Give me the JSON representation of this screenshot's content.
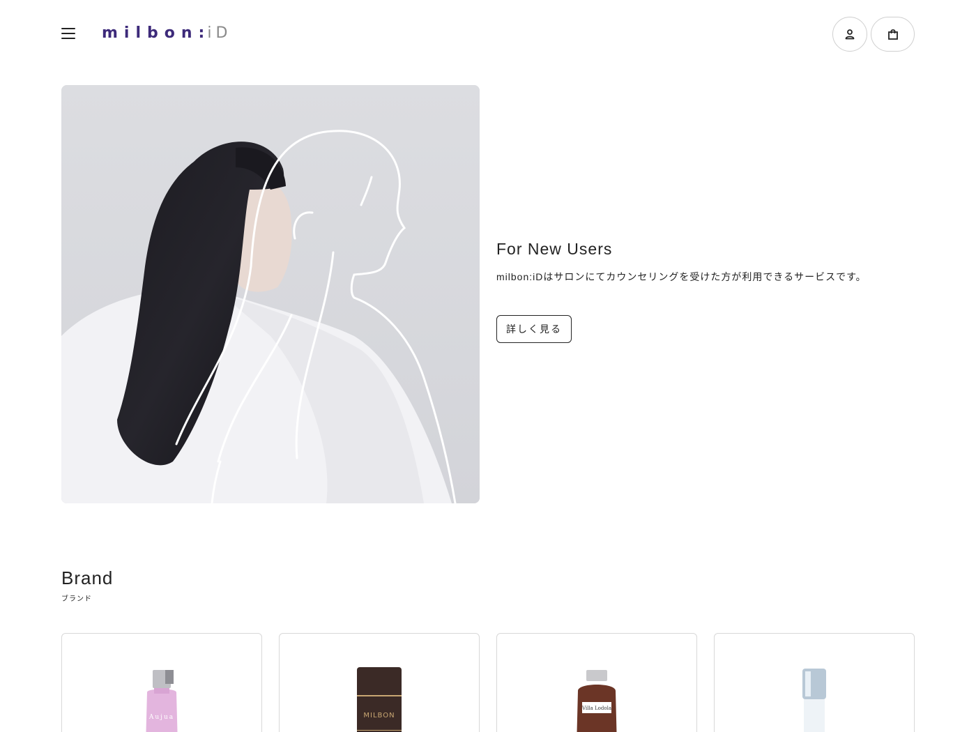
{
  "header": {
    "logo_main": "milbon",
    "logo_colon": ":",
    "logo_id": "iD"
  },
  "hero": {
    "title": "For New Users",
    "description": "milbon:iDはサロンにてカウンセリングを受けた方が利用できるサービスです。",
    "button_label": "詳しく見る"
  },
  "brand": {
    "title": "Brand",
    "subtitle": "ブランド",
    "cards": [
      {
        "product_text": "Aujua"
      },
      {
        "product_text": "MILBON"
      },
      {
        "product_text": "Villa Lodola"
      },
      {
        "product_text": ""
      }
    ]
  },
  "colors": {
    "logo_purple": "#3d2a7a",
    "logo_gray": "#8a8a8a",
    "text": "#222222",
    "border": "#d8d8d8"
  }
}
